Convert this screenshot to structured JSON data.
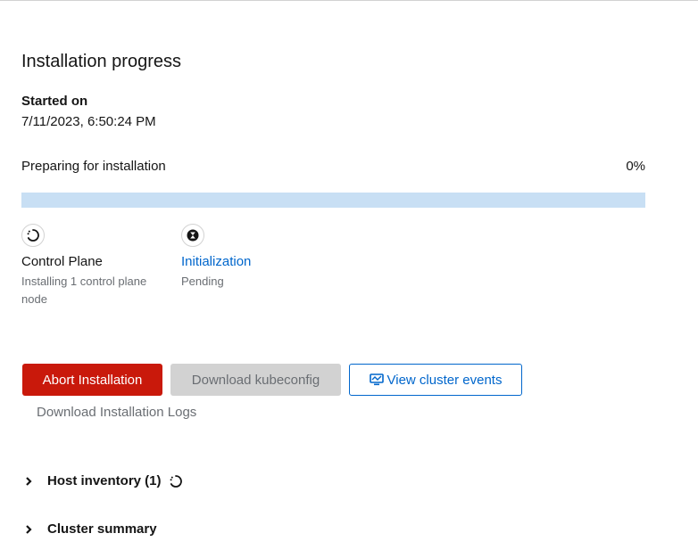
{
  "header": {
    "title": "Installation progress"
  },
  "started": {
    "label": "Started on",
    "value": "7/11/2023, 6:50:24 PM"
  },
  "progress": {
    "label": "Preparing for installation",
    "percent_text": "0%",
    "value": 0
  },
  "steps": [
    {
      "icon": "in-progress-icon",
      "title": "Control Plane",
      "description": "Installing 1 control plane node"
    },
    {
      "icon": "pending-icon",
      "title": "Initialization",
      "description": "Pending"
    }
  ],
  "actions": {
    "abort_label": "Abort Installation",
    "download_kubeconfig_label": "Download kubeconfig",
    "view_events_label": "View cluster events",
    "download_logs_label": "Download Installation Logs"
  },
  "sections": {
    "host_inventory": "Host inventory (1)",
    "cluster_summary": "Cluster summary"
  },
  "colors": {
    "danger": "#c9190b",
    "link": "#0066cc",
    "progress_track": "#c8dff4"
  }
}
